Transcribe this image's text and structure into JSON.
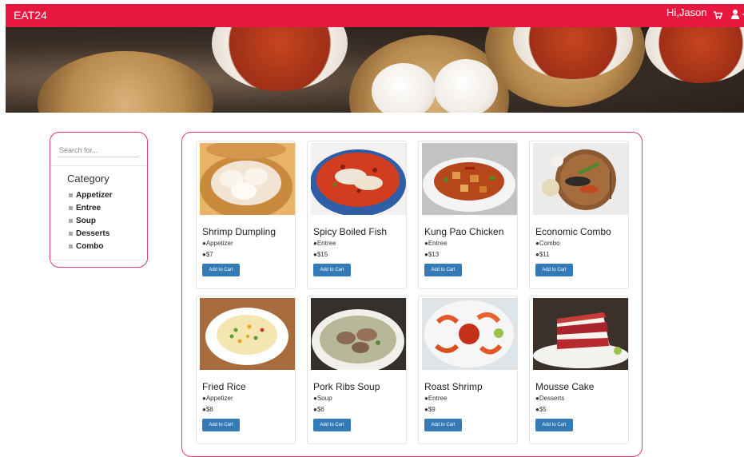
{
  "header": {
    "brand": "EAT24",
    "greeting": "Hi,Jason"
  },
  "sidebar": {
    "search_placeholder": "Search for...",
    "category_title": "Category",
    "categories": [
      "Appetizer",
      "Entree",
      "Soup",
      "Desserts",
      "Combo"
    ]
  },
  "products": [
    {
      "name": "Shrimp Dumpling",
      "category": "●Appetizer",
      "price": "●$7",
      "button": "Add to Cart"
    },
    {
      "name": "Spicy Boiled Fish",
      "category": "●Entree",
      "price": "●$15",
      "button": "Add to Cart"
    },
    {
      "name": "Kung Pao Chicken",
      "category": "●Entree",
      "price": "●$13",
      "button": "Add to Cart"
    },
    {
      "name": "Economic Combo",
      "category": "●Combo",
      "price": "●$11",
      "button": "Add to Cart"
    },
    {
      "name": "Fried Rice",
      "category": "●Appetizer",
      "price": "●$8",
      "button": "Add to Cart"
    },
    {
      "name": "Pork Ribs Soup",
      "category": "●Soup",
      "price": "●$6",
      "button": "Add to Cart"
    },
    {
      "name": "Roast Shrimp",
      "category": "●Entree",
      "price": "●$9",
      "button": "Add to Cart"
    },
    {
      "name": "Mousse Cake",
      "category": "●Desserts",
      "price": "●$5",
      "button": "Add to Cart"
    }
  ],
  "colors": {
    "brand": "#e8173f",
    "border_accent": "#e03a6a",
    "button": "#337ab7"
  }
}
